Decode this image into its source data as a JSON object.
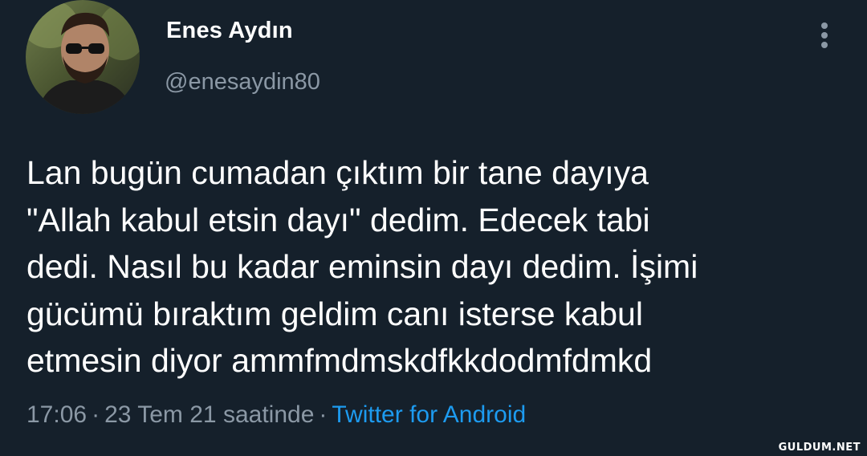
{
  "author": {
    "display_name": "Enes Aydın",
    "handle": "@enesaydin80"
  },
  "tweet": {
    "text": "Lan bugün cumadan çıktım bir tane dayıya\n\"Allah kabul etsin dayı\" dedim. Edecek tabi\ndedi. Nasıl bu kadar eminsin dayı dedim. İşimi\ngücümü bıraktım geldim canı isterse kabul\netmesin diyor ammfmdmskdfkkdodmfdmkd"
  },
  "meta": {
    "time": "17:06",
    "separator": "·",
    "date": "23 Tem 21 saatinde",
    "source": "Twitter for Android"
  },
  "icons": {
    "more": "more-vertical-icon",
    "avatar": "profile-photo"
  },
  "colors": {
    "background": "#15202b",
    "secondary_text": "#8b98a5",
    "link": "#1d9bf0"
  },
  "watermark": "GULDUM.NET"
}
